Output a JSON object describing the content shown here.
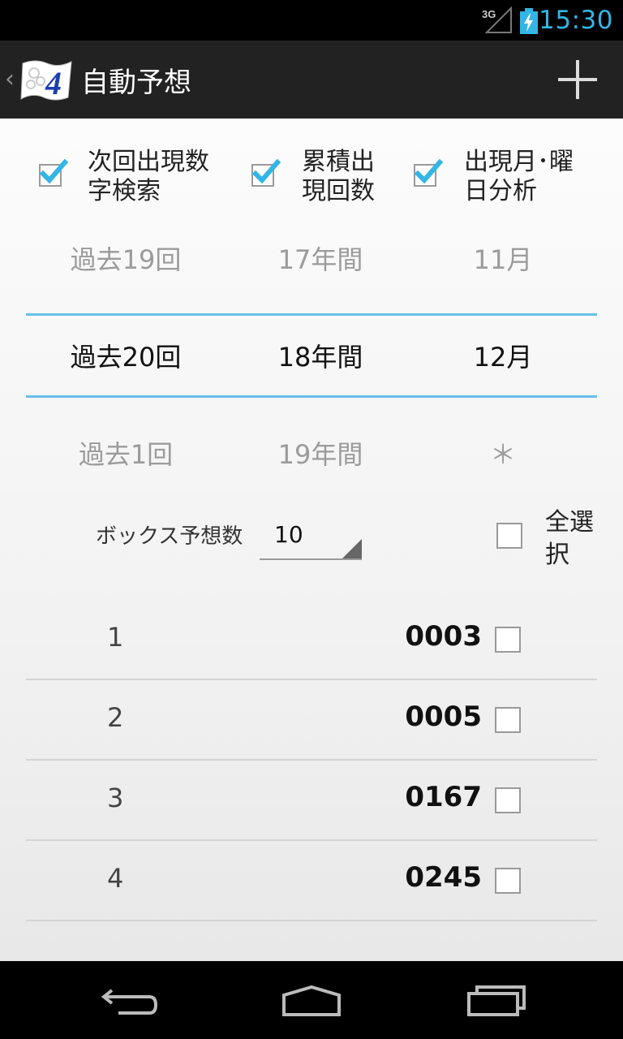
{
  "status_bar": {
    "network": "3G",
    "time": "15:30"
  },
  "action_bar": {
    "title": "自動予想",
    "logo_digit": "4"
  },
  "options": [
    {
      "label": "次回出現数字検索",
      "checked": true
    },
    {
      "label": "累積出現回数",
      "checked": true
    },
    {
      "label": "出現月･曜日分析",
      "checked": true
    }
  ],
  "picker": {
    "col1": [
      "過去19回",
      "過去20回",
      "過去1回"
    ],
    "col2": [
      "17年間",
      "18年間",
      "19年間"
    ],
    "col3": [
      "11月",
      "12月",
      "＊"
    ]
  },
  "box": {
    "label": "ボックス予想数",
    "value": "10"
  },
  "select_all": {
    "label": "全選択",
    "checked": false
  },
  "results": [
    {
      "index": "1",
      "number": "0003",
      "checked": false
    },
    {
      "index": "2",
      "number": "0005",
      "checked": false
    },
    {
      "index": "3",
      "number": "0167",
      "checked": false
    },
    {
      "index": "4",
      "number": "0245",
      "checked": false
    }
  ],
  "colors": {
    "accent": "#33b5e5",
    "divider": "#67c0e6",
    "action_bar": "#222222"
  }
}
